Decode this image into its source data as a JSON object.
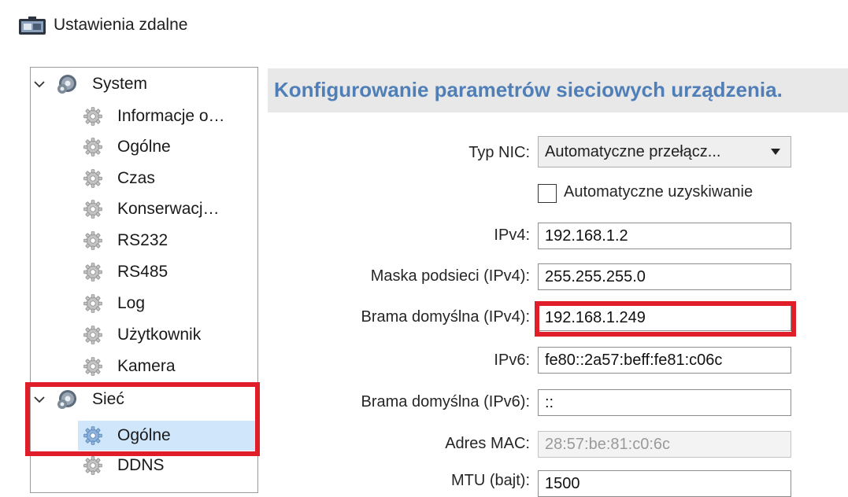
{
  "window": {
    "title": "Ustawienia zdalne"
  },
  "sidebar": {
    "groups": [
      {
        "label": "System",
        "expanded": true,
        "items": [
          "Informacje o…",
          "Ogólne",
          "Czas",
          "Konserwacj…",
          "RS232",
          "RS485",
          "Log",
          "Użytkownik",
          "Kamera"
        ]
      },
      {
        "label": "Sieć",
        "expanded": true,
        "items": [
          "Ogólne",
          "DDNS"
        ]
      }
    ],
    "selected": "Sieć / Ogólne"
  },
  "panel": {
    "title": "Konfigurowanie parametrów sieciowych urządzenia.",
    "nic_type": {
      "label": "Typ NIC:",
      "value": "Automatyczne przełącz..."
    },
    "auto_obtain": {
      "label": "Automatyczne uzyskiwanie",
      "checked": false
    },
    "fields": [
      {
        "label": "IPv4:",
        "value": "192.168.1.2"
      },
      {
        "label": "Maska podsieci (IPv4):",
        "value": "255.255.255.0"
      },
      {
        "label": "Brama domyślna (IPv4):",
        "value": "192.168.1.249"
      },
      {
        "label": "IPv6:",
        "value": "fe80::2a57:beff:fe81:c06c"
      },
      {
        "label": "Brama domyślna (IPv6):",
        "value": "::"
      },
      {
        "label": "Adres MAC:",
        "value": "28:57:be:81:c0:6c",
        "disabled": true
      },
      {
        "label": "MTU (bajt):",
        "value": "1500"
      }
    ]
  },
  "colors": {
    "highlight": "#e01e2a",
    "selection": "#cfe6fb",
    "title": "#4f7fb6"
  }
}
